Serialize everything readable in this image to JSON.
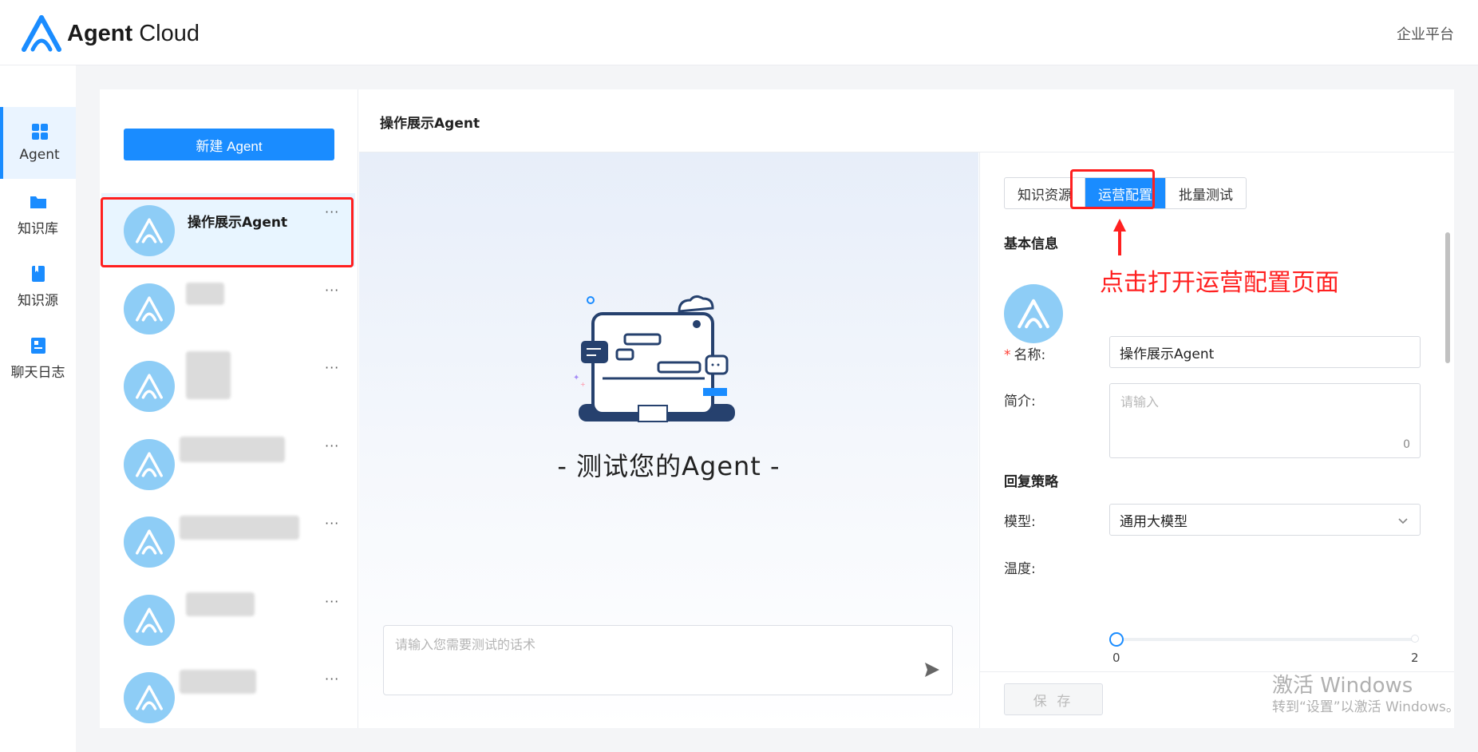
{
  "header": {
    "brand_bold": "Agent",
    "brand_light": "Cloud",
    "enterprise_link": "企业平台"
  },
  "rail": {
    "items": [
      {
        "label": "Agent",
        "icon": "grid-icon",
        "active": true
      },
      {
        "label": "知识库",
        "icon": "folder-icon"
      },
      {
        "label": "知识源",
        "icon": "book-icon"
      },
      {
        "label": "聊天日志",
        "icon": "log-icon"
      }
    ]
  },
  "agent_list": {
    "new_button": "新建 Agent",
    "items": [
      {
        "name": "操作展示Agent",
        "more": "···"
      },
      {
        "name": "",
        "more": "···"
      },
      {
        "name": "",
        "more": "···"
      },
      {
        "name": "",
        "more": "···"
      },
      {
        "name": "",
        "more": "···"
      },
      {
        "name": "",
        "more": "···"
      },
      {
        "name": "",
        "more": "···"
      }
    ]
  },
  "center": {
    "title": "操作展示Agent",
    "test_title": "- 测试您的Agent -",
    "chat_placeholder": "请输入您需要测试的话术"
  },
  "panel": {
    "tabs": [
      {
        "label": "知识资源"
      },
      {
        "label": "运营配置",
        "active": true
      },
      {
        "label": "批量测试"
      }
    ],
    "annotation": "点击打开运营配置页面",
    "basic_info": "基本信息",
    "name_label": "名称:",
    "name_value": "操作展示Agent",
    "intro_label": "简介:",
    "intro_placeholder": "请输入",
    "intro_count": "0",
    "reply_strategy": "回复策略",
    "model_label": "模型:",
    "model_value": "通用大模型",
    "temperature_label": "温度:",
    "temperature_value": 0,
    "temperature_min": "0",
    "temperature_max": "2",
    "save_label": "保 存"
  },
  "watermark": {
    "line1": "激活 Windows",
    "line2": "转到“设置”以激活 Windows。"
  },
  "colors": {
    "accent": "#1a8cff",
    "avatar": "#8ecdf6",
    "annotation": "#ff2020"
  }
}
